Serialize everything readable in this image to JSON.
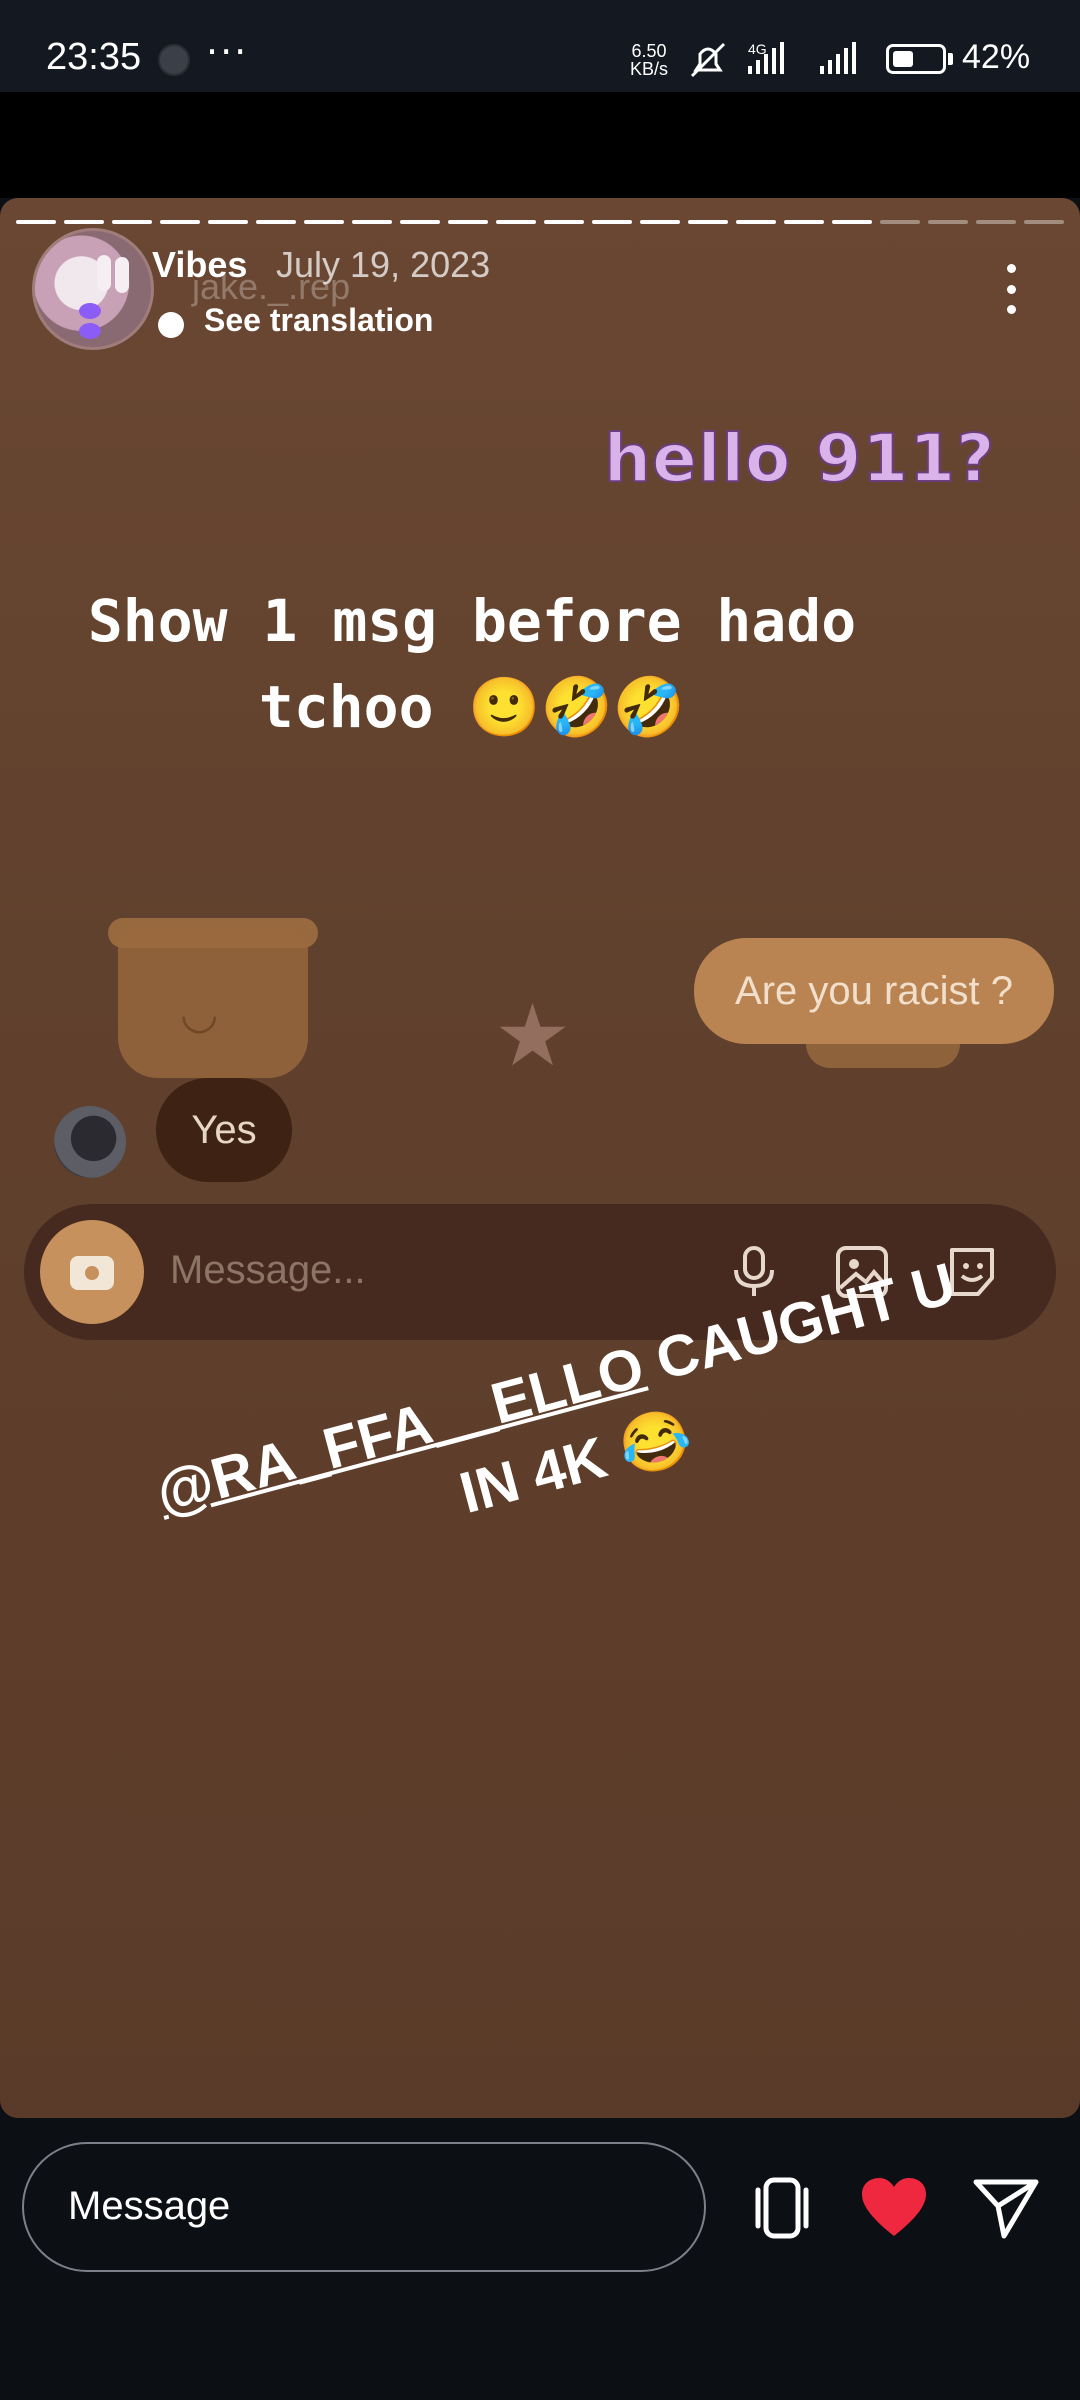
{
  "status_bar": {
    "time": "23:35",
    "more": "···",
    "net_speed_value": "6.50",
    "net_speed_unit": "KB/s",
    "network": "4G",
    "battery_percent": "42%",
    "battery_level": 0.42
  },
  "story": {
    "segments_total": 22,
    "segments_viewed": 18,
    "username": "Vibes",
    "date": "July 19, 2023",
    "ghost_username": "jake._.rep",
    "see_translation": "See translation",
    "overlay_text_1": "hello 911?",
    "caption_line1": "Show 1 msg before hado",
    "caption_line2": "tchoo 🙂🤣🤣",
    "chat_bubble_right": "Are you racist ?",
    "chat_bubble_left": "Yes",
    "chat_input_placeholder": "Message...",
    "caption2_mention": "@RA_FFA__ELLO",
    "caption2_line1_rest": " CAUGHT U",
    "caption2_line2": "IN 4K 😂"
  },
  "reply_bar": {
    "placeholder": "Message"
  },
  "colors": {
    "story_bg": "#64432f",
    "like": "#f0283f",
    "hello_text": "#d9b3ea"
  },
  "icons": [
    "camera-icon",
    "mic-icon",
    "gallery-icon",
    "sticker-icon",
    "more-icon",
    "reshare-icon",
    "heart-icon",
    "send-icon"
  ]
}
